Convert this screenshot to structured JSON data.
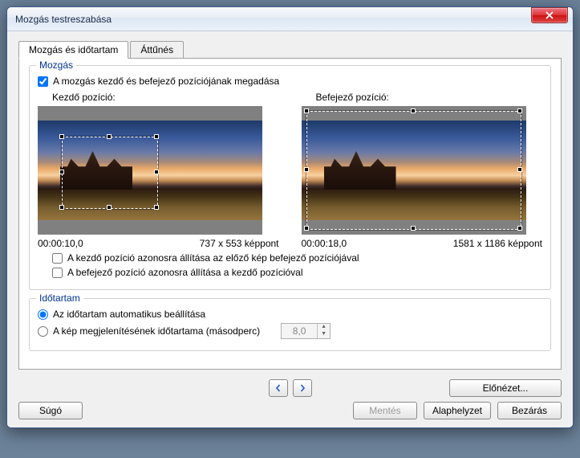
{
  "window": {
    "title": "Mozgás testreszabása"
  },
  "tabs": {
    "motion": "Mozgás és időtartam",
    "transition": "Áttűnés"
  },
  "motion": {
    "legend": "Mozgás",
    "specify": "A mozgás kezdő és befejező pozíciójának megadása",
    "start_label": "Kezdő pozíció:",
    "end_label": "Befejező pozíció:",
    "start_time": "00:00:10,0",
    "start_dim": "737 x 553 képpont",
    "end_time": "00:00:18,0",
    "end_dim": "1581 x 1186 képpont",
    "same_as_prev": "A kezdő pozíció azonosra állítása az előző kép befejező pozíciójával",
    "same_as_start": "A befejező pozíció azonosra állítása a kezdő pozícióval"
  },
  "duration": {
    "legend": "Időtartam",
    "auto": "Az időtartam automatikus beállítása",
    "manual": "A kép megjelenítésének időtartama (másodperc)",
    "seconds": "8,0"
  },
  "buttons": {
    "preview": "Előnézet...",
    "help": "Súgó",
    "save": "Mentés",
    "reset": "Alaphelyzet",
    "close": "Bezárás"
  }
}
